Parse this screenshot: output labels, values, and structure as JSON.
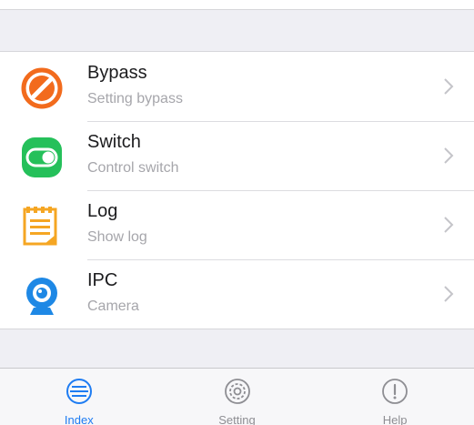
{
  "colors": {
    "accent": "#1e7cf2",
    "bypass_icon": "#f26b1d",
    "switch_icon": "#25c05a",
    "log_icon": "#f5a623",
    "ipc_icon": "#1e88e5",
    "inactive_tab": "#8e8e93"
  },
  "menu": {
    "items": [
      {
        "title": "Bypass",
        "subtitle": "Setting bypass",
        "icon": "bypass-icon"
      },
      {
        "title": "Switch",
        "subtitle": "Control switch",
        "icon": "switch-icon"
      },
      {
        "title": "Log",
        "subtitle": "Show log",
        "icon": "log-icon"
      },
      {
        "title": "IPC",
        "subtitle": "Camera",
        "icon": "camera-icon"
      }
    ]
  },
  "tabbar": {
    "tabs": [
      {
        "label": "Index",
        "icon": "index-icon",
        "selected": true
      },
      {
        "label": "Setting",
        "icon": "gear-icon",
        "selected": false
      },
      {
        "label": "Help",
        "icon": "help-icon",
        "selected": false
      }
    ]
  }
}
